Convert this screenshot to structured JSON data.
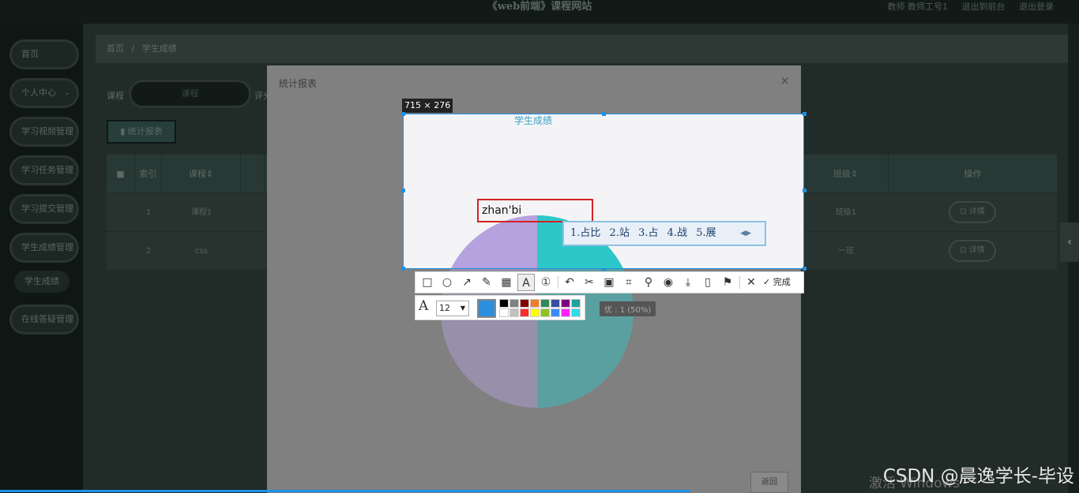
{
  "header": {
    "site_title": "《web前端》课程网站",
    "nav": [
      "教师 教师工号1",
      "退出到前台",
      "退出登录"
    ]
  },
  "sidebar": {
    "items": [
      {
        "label": "首页"
      },
      {
        "label": "个人中心"
      },
      {
        "label": "学习视频管理"
      },
      {
        "label": "学习任务管理"
      },
      {
        "label": "学习提交管理"
      },
      {
        "label": "学生成绩管理"
      },
      {
        "label": "学生成绩"
      },
      {
        "label": "在线答疑管理"
      }
    ]
  },
  "breadcrumb": {
    "home": "首页",
    "sep": "/",
    "current": "学生成绩"
  },
  "filter": {
    "course_label": "课程",
    "course_placeholder": "课程",
    "next_label": "评分"
  },
  "stats_button": "统计报表",
  "table": {
    "headers": [
      "索引",
      "课程",
      "",
      "班级",
      "操作"
    ],
    "rows": [
      {
        "index": "1",
        "course": "课程1",
        "class": "班级1",
        "action": "详情"
      },
      {
        "index": "2",
        "course": "css",
        "class": "一班",
        "action": "详情"
      }
    ]
  },
  "modal": {
    "title": "统计报表",
    "close": "×",
    "back_button": "返回"
  },
  "chart_data": {
    "type": "pie",
    "title": "学生成绩",
    "slices": [
      {
        "name": "优",
        "value": 1,
        "percent": 50,
        "color": "#2ec7c9"
      },
      {
        "name": "",
        "value": 1,
        "percent": 50,
        "color": "#b6a2de"
      }
    ],
    "tooltip": "优 : 1 (50%)"
  },
  "capture": {
    "size_label": "715 × 276",
    "ime_input": "zhan'bi",
    "candidates": [
      "1.占比",
      "2.站",
      "3.占",
      "4.战",
      "5.展"
    ],
    "done_label": "完成",
    "font_size": "12",
    "current_color": "#2b8fde",
    "palette": [
      "#000000",
      "#808080",
      "#800000",
      "#f07d2c",
      "#2e8b57",
      "#3a4fa0",
      "#800080",
      "#20a0a0",
      "#ffffff",
      "#c0c0c0",
      "#ff2a2a",
      "#ffff00",
      "#8dc21f",
      "#3b8bff",
      "#ff22ff",
      "#33d9e8"
    ]
  },
  "watermark": "CSDN @晨逸学长-毕设",
  "windows_activate": "激活 Windows"
}
